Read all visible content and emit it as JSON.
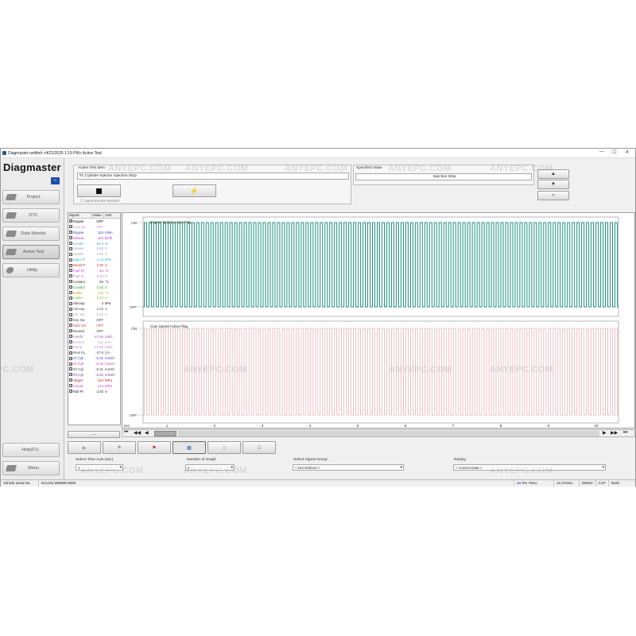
{
  "window": {
    "title": "Diagmaster:untitled <4/22/2025 1:15 PM> Active Test",
    "controls": [
      "—",
      "☐",
      "✕"
    ]
  },
  "sidebar": {
    "logo": "Diagmaster",
    "items": [
      {
        "label": "Project",
        "active": false
      },
      {
        "label": "DTC",
        "active": false
      },
      {
        "label": "Data Monitor",
        "active": false
      },
      {
        "label": "Active Test",
        "active": true
      },
      {
        "label": "Utility",
        "active": false
      }
    ],
    "help_label": "Help(F1)",
    "menu_label": "Menu"
  },
  "active_test": {
    "item_label": "Active Test Item",
    "item_value": "#1 Cylinder Injector Injection Stop",
    "specified_label": "Specified Value",
    "specified_value": "Injection Stop",
    "sync_label": "Synchronize Monitor"
  },
  "signals": {
    "headers": [
      "Signal",
      "Value",
      "Unit"
    ],
    "rows": [
      {
        "name": "Engine",
        "value": "OFF",
        "unit": "",
        "color": "#000000"
      },
      {
        "name": "Cam Sp",
        "value": "OFF",
        "unit": "",
        "color": "#d08ab0"
      },
      {
        "name": "Engine",
        "value": "124",
        "unit": "r/min",
        "color": "#1a3fbf"
      },
      {
        "name": "Vehicle",
        "value": "124",
        "unit": "km/h",
        "color": "#c02cc0"
      },
      {
        "name": "Accele",
        "value": "62.0",
        "unit": "%",
        "color": "#2bb0c0"
      },
      {
        "name": "Accele",
        "value": "2.42",
        "unit": "V",
        "color": "#8a8adf"
      },
      {
        "name": "Accele",
        "value": "2.42",
        "unit": "V",
        "color": "#a0a0a0"
      },
      {
        "name": "Vapor P",
        "value": "1.24",
        "unit": "kPa",
        "color": "#1fc0c0"
      },
      {
        "name": "Boost P",
        "value": "2.42",
        "unit": "V",
        "color": "#c01a1a"
      },
      {
        "name": "Fuel Te",
        "value": "64",
        "unit": "°C",
        "color": "#d030d0"
      },
      {
        "name": "Fuel Te",
        "value": "2.42",
        "unit": "V",
        "color": "#d06ad0"
      },
      {
        "name": "Coolant",
        "value": "84",
        "unit": "°C",
        "color": "#2a2a2a"
      },
      {
        "name": "Coolant",
        "value": "2.42",
        "unit": "V",
        "color": "#2aa02a"
      },
      {
        "name": "Intake",
        "value": "132",
        "unit": "°C",
        "color": "#d0a020"
      },
      {
        "name": "Intake",
        "value": "2.42",
        "unit": "V",
        "color": "#7ac030"
      },
      {
        "name": "Atmosp",
        "value": "4",
        "unit": "kPa",
        "color": "#202020"
      },
      {
        "name": "Atmosp",
        "value": "2.42",
        "unit": "V",
        "color": "#4a4a4a"
      },
      {
        "name": "A/C Sw",
        "value": "0.12",
        "unit": "V",
        "color": "#a0a0d0"
      },
      {
        "name": "Key Sw",
        "value": "OFF",
        "unit": "",
        "color": "#333333"
      },
      {
        "name": "Start Sw",
        "value": "OFF",
        "unit": "",
        "color": "#d04040"
      },
      {
        "name": "Neutral",
        "value": "OFF",
        "unit": "",
        "color": "#303030"
      },
      {
        "name": "Feedb",
        "value": "-47.56",
        "unit": "rad/s",
        "color": "#8060d0"
      },
      {
        "name": "Normal",
        "value": "131",
        "unit": "mm³",
        "color": "#c0a0d0"
      },
      {
        "name": "Pump",
        "value": "-47.56",
        "unit": "rad/s",
        "color": "#d080d0"
      },
      {
        "name": "Real Inj",
        "value": "-47.6",
        "unit": "CA",
        "color": "#404040"
      },
      {
        "name": "#1 Cyli",
        "value": "-0.31",
        "unit": "mm3/s",
        "color": "#3050c0"
      },
      {
        "name": "#2 Cyli",
        "value": "-0.31",
        "unit": "mm3/s",
        "color": "#d040a0"
      },
      {
        "name": "#3 Cyli",
        "value": "-0.31",
        "unit": "mm3/s",
        "color": "#404040"
      },
      {
        "name": "#4 Cyli",
        "value": "-0.31",
        "unit": "mm3/s",
        "color": "#6040a0"
      },
      {
        "name": "Target",
        "value": "124",
        "unit": "MPa",
        "color": "#c02020"
      },
      {
        "name": "Actual",
        "value": "124",
        "unit": "MPa",
        "color": "#d040c0"
      },
      {
        "name": "Rail Pr",
        "value": "2.42",
        "unit": "V",
        "color": "#202020"
      }
    ]
  },
  "charts": {
    "top": {
      "title": "Engine Speed Active Flag",
      "on": "ON",
      "off": "OFF",
      "color": "#1f9080"
    },
    "bottom": {
      "title": "Cam Speed Active Flag",
      "on": "ON",
      "off": "OFF",
      "color": "#e2a8b0"
    },
    "x_unit": "sec",
    "x_ticks": [
      "1",
      "2",
      "3",
      "4",
      "5",
      "6",
      "7",
      "8",
      "9",
      "10"
    ]
  },
  "controls": {
    "time_axis_label": "Select Time Axis (sec)",
    "time_axis_value": "1",
    "num_graph_label": "Number of Graph",
    "num_graph_value": "2",
    "signal_group_label": "Select Signal Group",
    "signal_group_value": "< Not Defined >",
    "replay_label": "Replay",
    "replay_value": "< Current Data >"
  },
  "status": {
    "vehicle": "Vehicle serial No.",
    "ecu": "ECUNo:999999-9999",
    "rate": "0% 79ms",
    "time": "10.476sec",
    "demo": "DEMO",
    "cap": "CAP",
    "num": "NUM"
  },
  "watermark": "ANYEPC.COM"
}
